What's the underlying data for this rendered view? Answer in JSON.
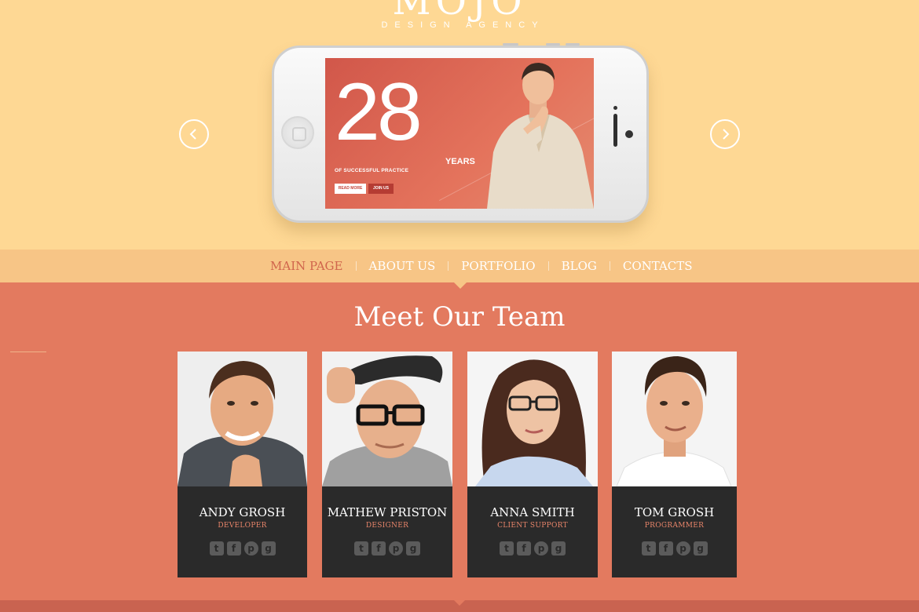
{
  "brand": {
    "name": "MOJO",
    "tagline": "DESIGN AGENCY"
  },
  "slider": {
    "prev_icon": "chevron-left-icon",
    "next_icon": "chevron-right-icon",
    "slide": {
      "number": "28",
      "unit": "YEARS",
      "caption": "OF SUCCESSFUL PRACTICE",
      "read_more": "READ MORE",
      "join_us": "JOIN US"
    }
  },
  "nav": {
    "items": [
      {
        "label": "MAIN PAGE",
        "active": true
      },
      {
        "label": "ABOUT US",
        "active": false
      },
      {
        "label": "PORTFOLIO",
        "active": false
      },
      {
        "label": "BLOG",
        "active": false
      },
      {
        "label": "CONTACTS",
        "active": false
      }
    ]
  },
  "team": {
    "title": "Meet Our Team",
    "members": [
      {
        "name": "ANDY GROSH",
        "role": "DEVELOPER"
      },
      {
        "name": "MATHEW PRISTON",
        "role": "DESIGNER"
      },
      {
        "name": "ANNA SMITH",
        "role": "CLIENT SUPPORT"
      },
      {
        "name": "TOM GROSH",
        "role": "PROGRAMMER"
      }
    ],
    "social_icons": [
      "twitter-icon",
      "facebook-icon",
      "pinterest-icon",
      "google-plus-icon"
    ]
  },
  "colors": {
    "hero_bg": "#fed894",
    "nav_bg": "#f7c586",
    "nav_active": "#d0654c",
    "team_bg": "#e37a5f",
    "card_bg": "#2a2a2a",
    "role_text": "#e9856a"
  }
}
